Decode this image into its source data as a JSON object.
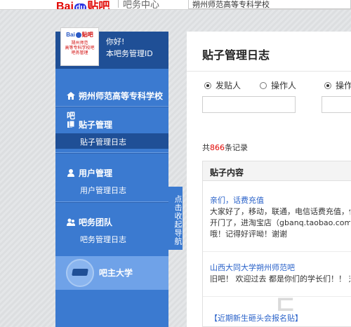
{
  "header": {
    "logo_main": "Bai",
    "logo_du": "du",
    "logo_tieba": "贴吧",
    "section": "吧务中心",
    "search_value": "朔州师范高等专科学校"
  },
  "sidebar": {
    "avatar": {
      "brand_bai": "Bai",
      "brand_tieba": "贴吧",
      "lines": [
        "朔州师范",
        "高等专科学校吧",
        "吧务管理"
      ]
    },
    "hello": "你好!",
    "role": "本吧务管理ID",
    "forum_name": "朔州师范高等专科学校吧",
    "groups": [
      {
        "title": "贴子管理",
        "items": [
          {
            "label": "贴子管理日志",
            "active": true
          }
        ]
      },
      {
        "title": "用户管理",
        "items": [
          {
            "label": "用户管理日志",
            "active": false
          }
        ]
      },
      {
        "title": "吧务团队",
        "items": [
          {
            "label": "吧务管理日志",
            "active": false
          }
        ]
      }
    ],
    "college": "吧主大学",
    "collapse_tab": "点击收起导航"
  },
  "main": {
    "title": "贴子管理日志",
    "filters": [
      {
        "label": "发贴人",
        "checked": true
      },
      {
        "label": "操作人",
        "checked": false
      },
      {
        "label": "操作",
        "checked": true
      }
    ],
    "count_prefix": "共",
    "count": "866",
    "count_suffix": "条记录",
    "table_header": "贴子内容",
    "posts": [
      {
        "title": "亲们，话费充值",
        "lines": [
          "大家好了，移动，联通，电信话费充值，你",
          "开门了，进淘宝店（gbanq.taobao.com），",
          "哦！记得好评呦！谢谢"
        ]
      },
      {
        "title": "山西大同大学朔州师范吧",
        "lines": [
          "旧吧！ 欢迎过去 都是你们的学长们！！ 对"
        ]
      },
      {
        "title": "【近期新生砸头会报名贴】",
        "lines": []
      }
    ]
  },
  "watermark": "ㄷ"
}
